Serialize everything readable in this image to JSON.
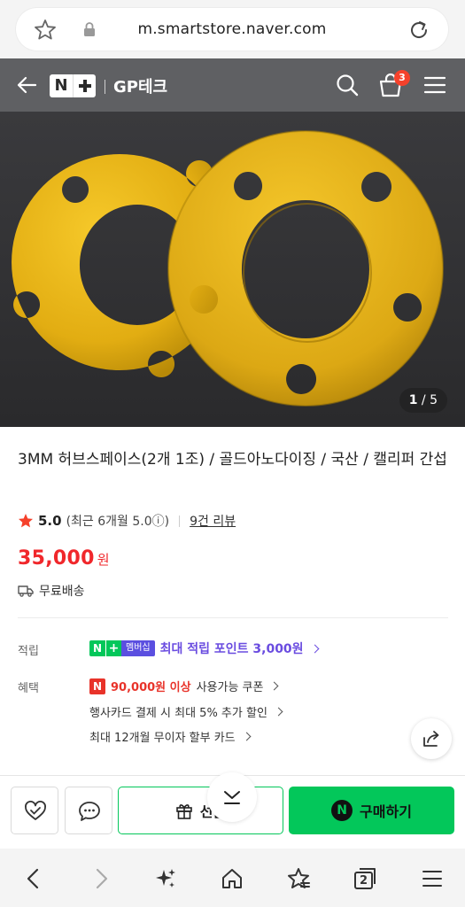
{
  "browser": {
    "url": "m.smartstore.naver.com",
    "tab_count": "2"
  },
  "header": {
    "brand_n": "N",
    "store_name": "GP테크",
    "cart_count": "3"
  },
  "gallery": {
    "current": "1",
    "total": "5",
    "separator": "/"
  },
  "product": {
    "title": "3MM 허브스페이스(2개 1조) / 골드아노다이징 / 국산 / 캘리퍼 간섭",
    "rating": "5.0",
    "rating_detail": "(최근 6개월 5.0ⓘ)",
    "reviews": "9건 리뷰",
    "price": "35,000",
    "currency": "원",
    "shipping": "무료배송"
  },
  "benefits": {
    "points_label": "적립",
    "membership_tag": "멤버십",
    "points_text": "최대 적립 포인트 3,000원",
    "benefit_label": "혜택",
    "coupon_amount": "90,000원 이상",
    "coupon_text": "사용가능 쿠폰",
    "card_discount": "행사카드 결제 시 최대 5% 추가 할인",
    "installment": "최대 12개월 무이자 할부 카드"
  },
  "buybar": {
    "gift_label": "선물",
    "buy_label": "구매하기"
  },
  "colors": {
    "naver_green": "#03c75a",
    "price_red": "#f0272b",
    "membership_purple": "#6a4ce0",
    "header_gray": "#5f6063"
  }
}
